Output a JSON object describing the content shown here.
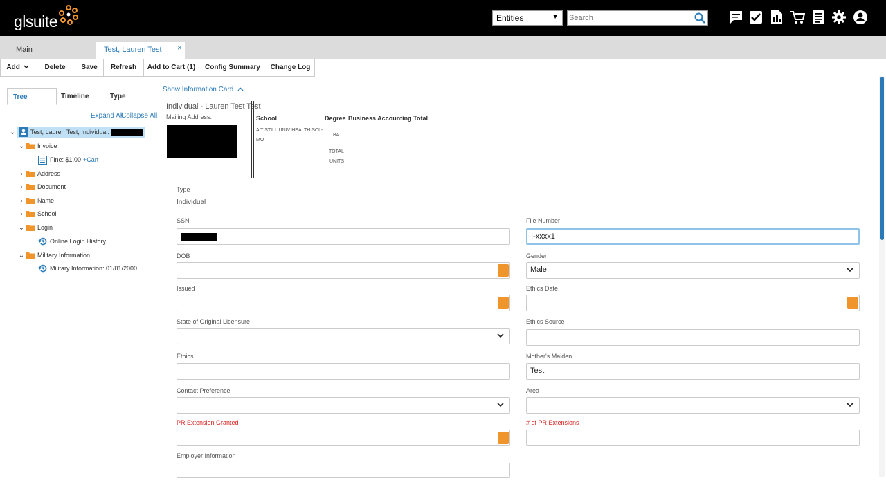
{
  "header": {
    "logo_text": "glsuite",
    "entity_select": "Entities",
    "search_placeholder": "Search",
    "icons": [
      "chat-icon",
      "checkbox-icon",
      "report-icon",
      "cart-icon",
      "document-icon",
      "gear-icon",
      "user-icon"
    ]
  },
  "tabs": {
    "main": "Main",
    "active": "Test, Lauren Test",
    "close": "×"
  },
  "toolbar": {
    "add": "Add",
    "delete": "Delete",
    "save": "Save",
    "refresh": "Refresh",
    "add_to_cart": "Add to Cart (1)",
    "config_summary": "Config Summary",
    "change_log": "Change Log"
  },
  "left_panel": {
    "tabs": [
      "Tree",
      "Timeline",
      "Type"
    ],
    "expand_all": "Expand All",
    "collapse_all": "Collapse All",
    "tree": {
      "root": "Test, Lauren Test, Individual:",
      "invoice": "Invoice",
      "fine": "Fine: $1.00",
      "cart": "+Cart",
      "address": "Address",
      "document": "Document",
      "name": "Name",
      "school": "School",
      "login": "Login",
      "online_login_history": "Online Login History",
      "military_information": "Military Information",
      "military_record": "Military Information: 01/01/2000"
    }
  },
  "info_card": {
    "toggle": "Show Information Card",
    "title": "Individual - Lauren Test Test",
    "mailing": "Mailing Address:",
    "school_header": "School",
    "school_value_1": "A T STILL UNIV HEALTH SCI -",
    "school_value_2": "MO",
    "degree_header": "Degree",
    "degree_value": "BA",
    "total_units_1": "TOTAL",
    "total_units_2": "UNITS",
    "business_accounting": "Business Accounting Total"
  },
  "form": {
    "type_label": "Type",
    "type_value": "Individual",
    "ssn": "SSN",
    "file_number": "File Number",
    "file_number_value": "I-xxxx1",
    "dob": "DOB",
    "gender": "Gender",
    "gender_value": "Male",
    "issued": "Issued",
    "ethics_date": "Ethics Date",
    "state_licensure": "State of Original Licensure",
    "ethics_source": "Ethics Source",
    "ethics": "Ethics",
    "mothers_maiden": "Mother's Maiden",
    "mothers_maiden_value": "Test",
    "contact_preference": "Contact Preference",
    "area": "Area",
    "pr_extension_granted": "PR Extension Granted",
    "pr_extensions_count": "# of PR Extensions",
    "employer_information": "Employer Information"
  },
  "colors": {
    "accent": "#2a7ab8",
    "calendar": "#f0952b",
    "required": "#d9231e",
    "header_bg": "#000000"
  }
}
